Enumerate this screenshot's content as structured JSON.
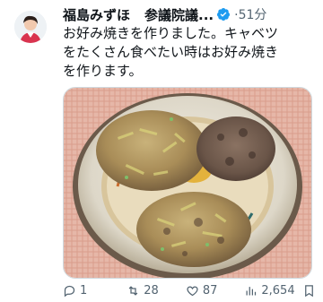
{
  "author": {
    "name": "福島みずほ",
    "title": "参議院議...",
    "time": "·51分",
    "verified": true
  },
  "tweet": {
    "text_line1": "お好み焼きを作りました。キャベツ",
    "text_line2": "をたくさん食べたい時はお好み焼き",
    "text_line3": "を作ります。"
  },
  "metrics": {
    "replies": "1",
    "retweets": "28",
    "likes": "87",
    "views": "2,654"
  },
  "colors": {
    "verified": "#1d9bf0",
    "muted": "#536471",
    "text": "#0f1419"
  }
}
